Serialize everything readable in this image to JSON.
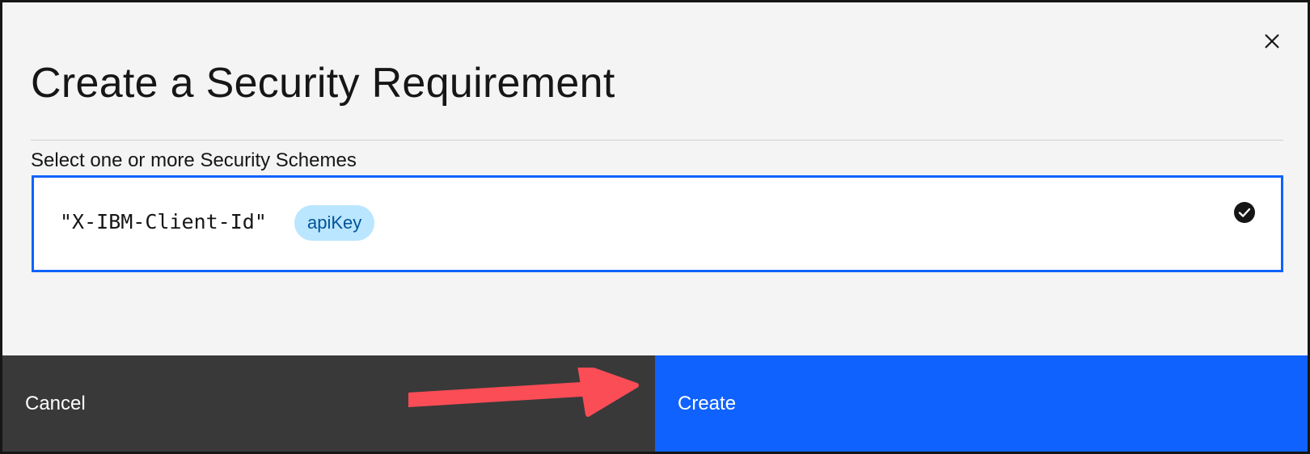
{
  "dialog": {
    "title": "Create a Security Requirement",
    "close_icon": "close-icon"
  },
  "field": {
    "label": "Select one or more Security Schemes",
    "option": {
      "name": "\"X-IBM-Client-Id\"",
      "tag": "apiKey",
      "selected": true,
      "check_icon": "checkmark-filled-icon"
    }
  },
  "footer": {
    "cancel_label": "Cancel",
    "create_label": "Create"
  },
  "annotation": {
    "arrow_icon": "pointer-arrow-icon",
    "arrow_color": "#fa4d56"
  },
  "colors": {
    "primary": "#0f62fe",
    "secondary": "#393939",
    "tag_bg": "#bae6ff",
    "tag_text": "#00539a"
  }
}
